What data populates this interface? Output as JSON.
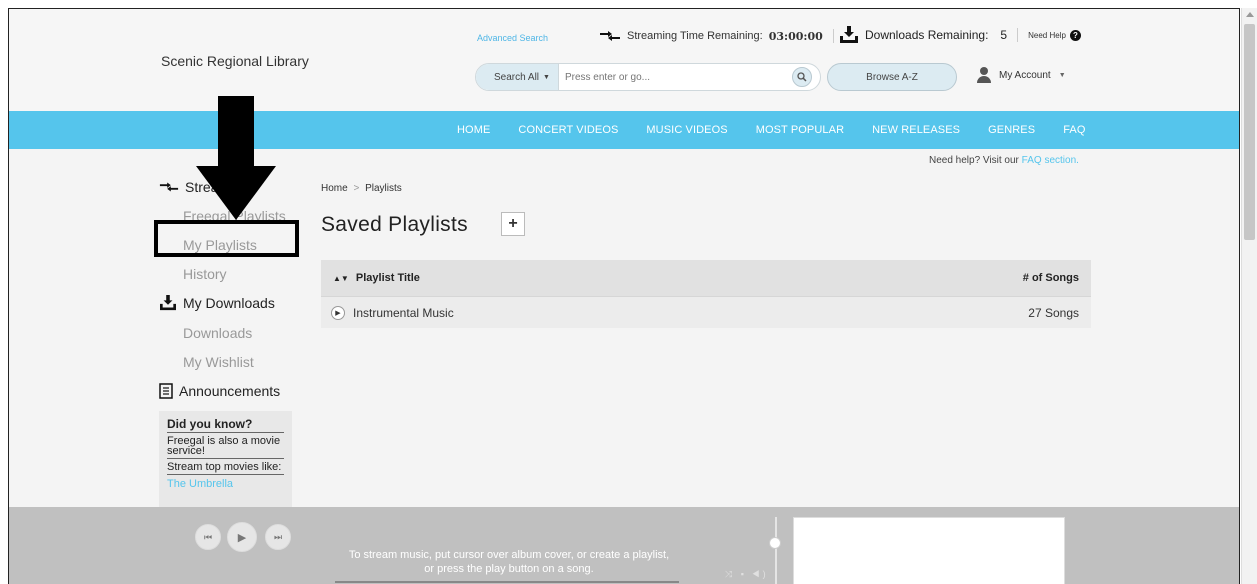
{
  "header": {
    "library_name": "Scenic Regional Library",
    "advanced_search": "Advanced Search",
    "streaming_label": "Streaming Time Remaining:",
    "streaming_value": "03:00:00",
    "downloads_label": "Downloads Remaining:",
    "downloads_value": "5",
    "need_help": "Need Help",
    "search_scope": "Search All",
    "search_placeholder": "Press enter or go...",
    "browse_label": "Browse A-Z",
    "account_label": "My Account"
  },
  "nav": {
    "items": [
      "HOME",
      "CONCERT VIDEOS",
      "MUSIC VIDEOS",
      "MOST POPULAR",
      "NEW RELEASES",
      "GENRES",
      "FAQ"
    ]
  },
  "sidebar": {
    "section_streaming": "Streaming",
    "freegal_playlists": "Freegal Playlists",
    "my_playlists": "My Playlists",
    "history": "History",
    "section_downloads": "My Downloads",
    "downloads": "Downloads",
    "wishlist": "My Wishlist",
    "announcements": "Announcements",
    "did_you_know": {
      "title": "Did you know?",
      "fact1": "Freegal is also a movie service!",
      "fact2": "Stream top movies like:",
      "link": "The Umbrella"
    }
  },
  "main": {
    "help_text": "Need help? Visit our",
    "help_link": "FAQ section.",
    "breadcrumb_home": "Home",
    "breadcrumb_current": "Playlists",
    "page_title": "Saved Playlists",
    "add_button": "+",
    "table": {
      "col_title": "Playlist Title",
      "col_songs": "# of Songs",
      "rows": [
        {
          "title": "Instrumental Music",
          "songs": "27 Songs"
        }
      ]
    }
  },
  "player": {
    "message_line1": "To stream music, put cursor over album cover, or create a playlist,",
    "message_line2": "or press the play button on a song."
  },
  "colors": {
    "nav_bg": "#55c5ec",
    "accent_link": "#55c5ec",
    "player_bg": "#c0c0c0"
  }
}
